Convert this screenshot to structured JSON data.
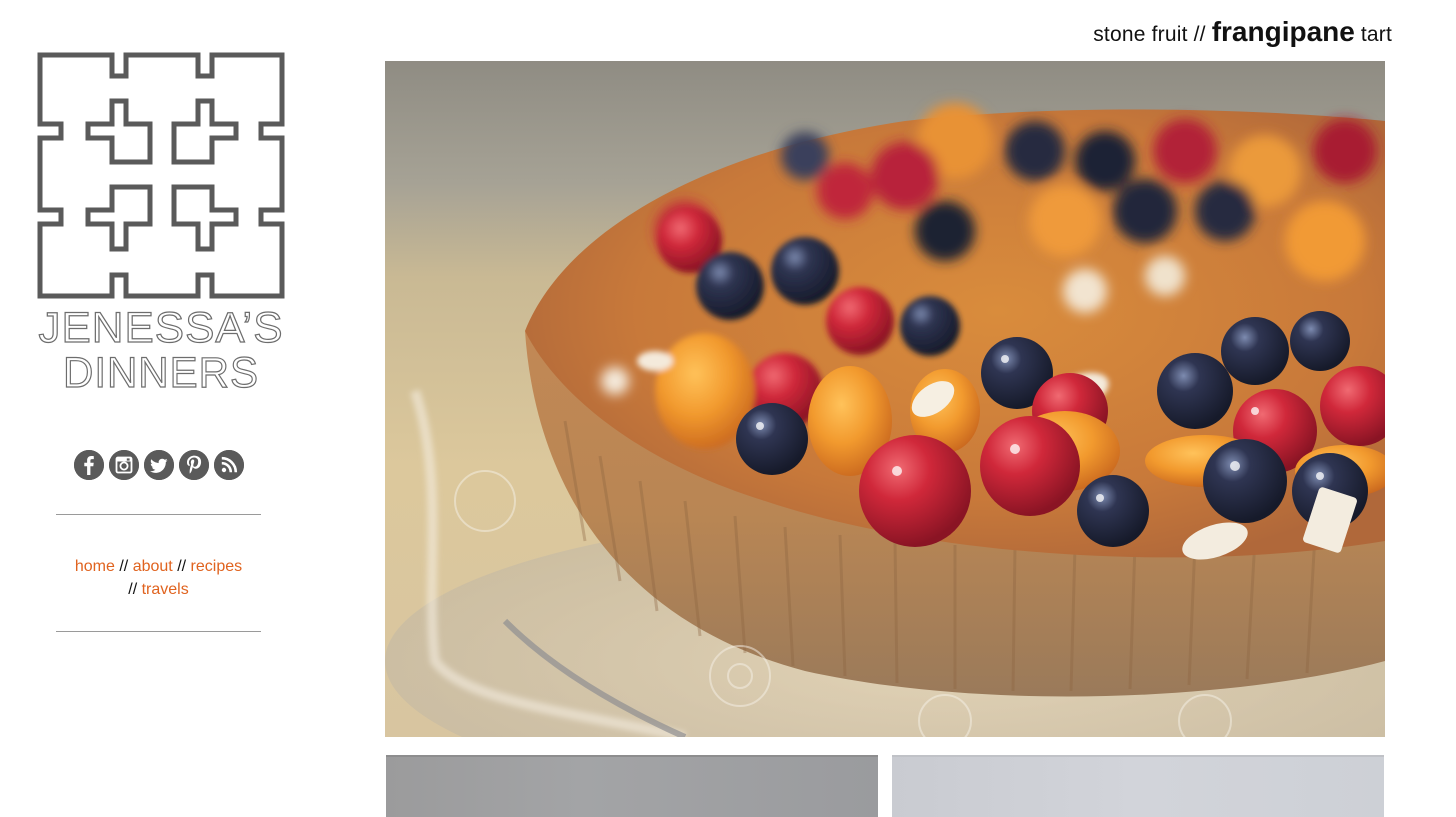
{
  "site": {
    "logo_line1": "JENESSA’S",
    "logo_line2": "DINNERS",
    "logo_icon": "greek-key-cross-emblem"
  },
  "social": [
    {
      "name": "facebook",
      "icon": "facebook-icon",
      "glyph": "f"
    },
    {
      "name": "instagram",
      "icon": "instagram-icon",
      "glyph": "camera"
    },
    {
      "name": "twitter",
      "icon": "twitter-icon",
      "glyph": "bird"
    },
    {
      "name": "pinterest",
      "icon": "pinterest-icon",
      "glyph": "p"
    },
    {
      "name": "rss",
      "icon": "rss-icon",
      "glyph": "feed"
    }
  ],
  "nav": {
    "items": [
      {
        "label": "home"
      },
      {
        "label": "about"
      },
      {
        "label": "recipes"
      },
      {
        "label": "travels"
      }
    ],
    "separator": "//"
  },
  "post": {
    "title_words": [
      "stone",
      "fruit",
      "//",
      "frangipane",
      "tart"
    ],
    "emphasis_word": "frangipane",
    "hero_alt": "Frangipane tart topped with apricots, raspberries, blueberries and sliced almonds on a glass cake stand"
  },
  "colors": {
    "link": "#e0631f",
    "logo_gray": "#5a5a5a",
    "rule": "#9a9a9a",
    "text": "#111111"
  }
}
